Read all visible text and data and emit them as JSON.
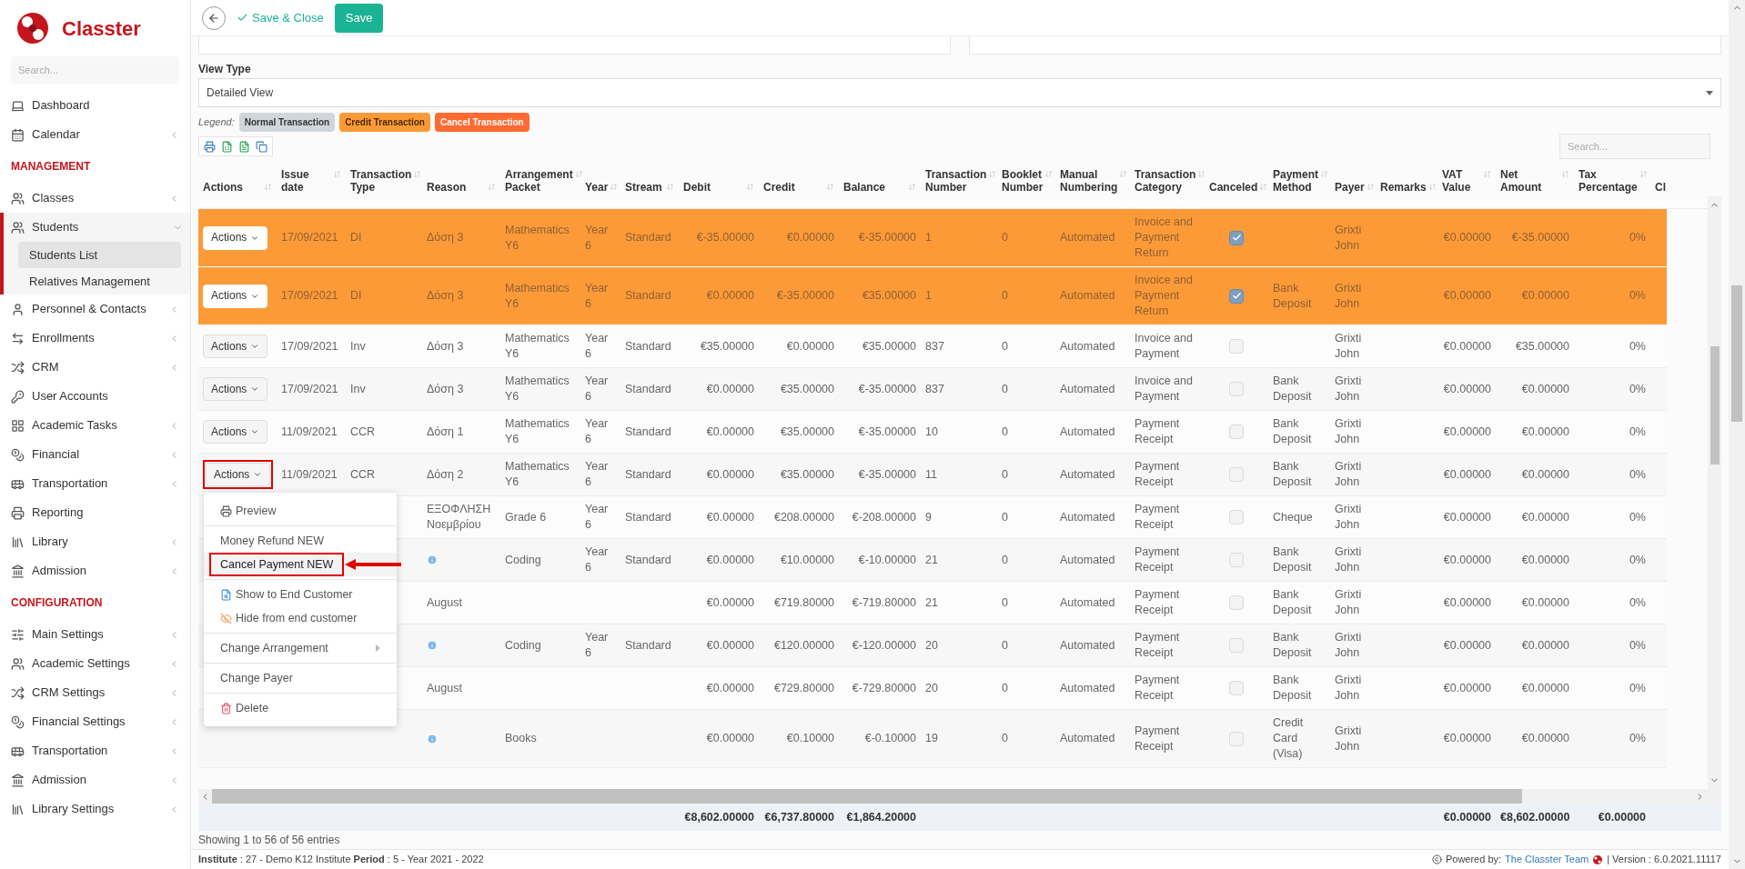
{
  "sidebar": {
    "logo": "Classter",
    "search": {
      "placeholder": "Search..."
    },
    "sections": [
      {
        "items": [
          {
            "label": "Dashboard",
            "submenu": false,
            "expanded": false
          },
          {
            "label": "Calendar",
            "submenu": true,
            "expanded": false
          }
        ]
      },
      {
        "heading": "MANAGEMENT",
        "items": [
          {
            "label": "Classes",
            "submenu": true,
            "expanded": false
          },
          {
            "label": "Students",
            "submenu": true,
            "expanded": true,
            "children": [
              {
                "label": "Students List",
                "selected": true
              },
              {
                "label": "Relatives Management",
                "selected": false
              }
            ]
          },
          {
            "label": "Personnel & Contacts",
            "submenu": true,
            "expanded": false
          },
          {
            "label": "Enrollments",
            "submenu": true,
            "expanded": false
          },
          {
            "label": "CRM",
            "submenu": true,
            "expanded": false
          },
          {
            "label": "User Accounts",
            "submenu": false,
            "expanded": false
          },
          {
            "label": "Academic Tasks",
            "submenu": true,
            "expanded": false
          },
          {
            "label": "Financial",
            "submenu": true,
            "expanded": false
          },
          {
            "label": "Transportation",
            "submenu": true,
            "expanded": false
          },
          {
            "label": "Reporting",
            "submenu": false,
            "expanded": false
          },
          {
            "label": "Library",
            "submenu": true,
            "expanded": false
          },
          {
            "label": "Admission",
            "submenu": true,
            "expanded": false
          }
        ]
      },
      {
        "heading": "CONFIGURATION",
        "items": [
          {
            "label": "Main Settings",
            "submenu": true,
            "expanded": false
          },
          {
            "label": "Academic Settings",
            "submenu": true,
            "expanded": false
          },
          {
            "label": "CRM Settings",
            "submenu": true,
            "expanded": false
          },
          {
            "label": "Financial Settings",
            "submenu": true,
            "expanded": false
          },
          {
            "label": "Transportation",
            "submenu": true,
            "expanded": false
          },
          {
            "label": "Admission",
            "submenu": true,
            "expanded": false
          },
          {
            "label": "Library Settings",
            "submenu": true,
            "expanded": false
          }
        ]
      }
    ]
  },
  "toolbar": {
    "save_close": "Save & Close",
    "save": "Save"
  },
  "view_type": {
    "label": "View Type",
    "value": "Detailed View"
  },
  "legend": {
    "label": "Legend:",
    "items": [
      {
        "label": "Normal Transaction",
        "color": "#d1d6db"
      },
      {
        "label": "Credit Transaction",
        "color": "#fd9a38"
      },
      {
        "label": "Cancel Transaction",
        "color": "#ff6a33"
      }
    ]
  },
  "table_search": {
    "placeholder": "Search..."
  },
  "table": {
    "columns": [
      "Actions",
      "Issue date",
      "Transaction Type",
      "Reason",
      "Arrangement Packet",
      "Year",
      "Stream",
      "Debit",
      "Credit",
      "Balance",
      "Transaction Number",
      "Booklet Number",
      "Manual Numbering",
      "Transaction Category",
      "Canceled",
      "Payment Method",
      "Payer",
      "Remarks",
      "VAT Value",
      "Net Amount",
      "Tax Percentage",
      "Cl"
    ],
    "rows": [
      {
        "kind": "credit",
        "actions": "Actions",
        "actions_highlighted": false,
        "issue_date": "17/09/2021",
        "transaction_type": "DI",
        "reason": "Δόση 3",
        "info": false,
        "arrangement_packet": "Mathematics Y6",
        "year": "Year 6",
        "stream": "Standard",
        "debit": "€-35.00000",
        "credit": "€0.00000",
        "balance": "€-35.00000",
        "transaction_number": "1",
        "booklet_number": "0",
        "manual_numbering": "Automated",
        "transaction_category": "Invoice and Payment Return",
        "canceled": true,
        "payer": "Grixti John",
        "vat_value": "€0.00000",
        "net_amount": "€-35.00000",
        "tax_percentage": "0%"
      },
      {
        "kind": "credit",
        "actions": "Actions",
        "actions_highlighted": false,
        "issue_date": "17/09/2021",
        "transaction_type": "DI",
        "reason": "Δόση 3",
        "info": false,
        "arrangement_packet": "Mathematics Y6",
        "year": "Year 6",
        "stream": "Standard",
        "debit": "€0.00000",
        "credit": "€-35.00000",
        "balance": "€35.00000",
        "transaction_number": "1",
        "booklet_number": "0",
        "manual_numbering": "Automated",
        "transaction_category": "Invoice and Payment Return",
        "canceled": true,
        "payment_method": "Bank Deposit",
        "payer": "Grixti John",
        "vat_value": "€0.00000",
        "net_amount": "€0.00000",
        "tax_percentage": "0%"
      },
      {
        "kind": "normal",
        "actions": "Actions",
        "actions_highlighted": false,
        "issue_date": "17/09/2021",
        "transaction_type": "Inv",
        "reason": "Δόση 3",
        "info": false,
        "arrangement_packet": "Mathematics Y6",
        "year": "Year 6",
        "stream": "Standard",
        "debit": "€35.00000",
        "credit": "€0.00000",
        "balance": "€35.00000",
        "transaction_number": "837",
        "booklet_number": "0",
        "manual_numbering": "Automated",
        "transaction_category": "Invoice and Payment",
        "canceled": false,
        "payer": "Grixti John",
        "vat_value": "€0.00000",
        "net_amount": "€35.00000",
        "tax_percentage": "0%"
      },
      {
        "kind": "normal",
        "actions": "Actions",
        "actions_highlighted": false,
        "issue_date": "17/09/2021",
        "transaction_type": "Inv",
        "reason": "Δόση 3",
        "info": false,
        "arrangement_packet": "Mathematics Y6",
        "year": "Year 6",
        "stream": "Standard",
        "debit": "€0.00000",
        "credit": "€35.00000",
        "balance": "€-35.00000",
        "transaction_number": "837",
        "booklet_number": "0",
        "manual_numbering": "Automated",
        "transaction_category": "Invoice and Payment",
        "canceled": false,
        "payment_method": "Bank Deposit",
        "payer": "Grixti John",
        "vat_value": "€0.00000",
        "net_amount": "€0.00000",
        "tax_percentage": "0%"
      },
      {
        "kind": "normal",
        "actions": "Actions",
        "actions_highlighted": false,
        "issue_date": "11/09/2021",
        "transaction_type": "CCR",
        "reason": "Δόση 1",
        "info": false,
        "arrangement_packet": "Mathematics Y6",
        "year": "Year 6",
        "stream": "Standard",
        "debit": "€0.00000",
        "credit": "€35.00000",
        "balance": "€-35.00000",
        "transaction_number": "10",
        "booklet_number": "0",
        "manual_numbering": "Automated",
        "transaction_category": "Payment Receipt",
        "canceled": false,
        "payment_method": "Bank Deposit",
        "payer": "Grixti John",
        "vat_value": "€0.00000",
        "net_amount": "€0.00000",
        "tax_percentage": "0%"
      },
      {
        "kind": "normal",
        "actions": "Actions",
        "actions_highlighted": true,
        "issue_date": "11/09/2021",
        "transaction_type": "CCR",
        "reason": "Δόση 2",
        "info": false,
        "arrangement_packet": "Mathematics Y6",
        "year": "Year 6",
        "stream": "Standard",
        "debit": "€0.00000",
        "credit": "€35.00000",
        "balance": "€-35.00000",
        "transaction_number": "11",
        "booklet_number": "0",
        "manual_numbering": "Automated",
        "transaction_category": "Payment Receipt",
        "canceled": false,
        "payment_method": "Bank Deposit",
        "payer": "Grixti John",
        "vat_value": "€0.00000",
        "net_amount": "€0.00000",
        "tax_percentage": "0%"
      },
      {
        "kind": "normal",
        "reason": "ΕΞΟΦΛΗΣΗ Νοεμβρίου",
        "info": false,
        "arrangement_packet": "Grade 6",
        "year": "Year 6",
        "stream": "Standard",
        "debit": "€0.00000",
        "credit": "€208.00000",
        "balance": "€-208.00000",
        "transaction_number": "9",
        "booklet_number": "0",
        "manual_numbering": "Automated",
        "transaction_category": "Payment Receipt",
        "canceled": false,
        "payment_method": "Cheque",
        "payer": "Grixti John",
        "vat_value": "€0.00000",
        "net_amount": "€0.00000",
        "tax_percentage": "0%"
      },
      {
        "kind": "normal",
        "info": true,
        "arrangement_packet": "Coding",
        "year": "Year 6",
        "stream": "Standard",
        "debit": "€0.00000",
        "credit": "€10.00000",
        "balance": "€-10.00000",
        "transaction_number": "21",
        "booklet_number": "0",
        "manual_numbering": "Automated",
        "transaction_category": "Payment Receipt",
        "canceled": false,
        "payment_method": "Bank Deposit",
        "payer": "Grixti John",
        "vat_value": "€0.00000",
        "net_amount": "€0.00000",
        "tax_percentage": "0%"
      },
      {
        "kind": "normal",
        "reason": "August",
        "info": false,
        "debit": "€0.00000",
        "credit": "€719.80000",
        "balance": "€-719.80000",
        "transaction_number": "21",
        "booklet_number": "0",
        "manual_numbering": "Automated",
        "transaction_category": "Payment Receipt",
        "canceled": false,
        "payment_method": "Bank Deposit",
        "payer": "Grixti John",
        "vat_value": "€0.00000",
        "net_amount": "€0.00000",
        "tax_percentage": "0%"
      },
      {
        "kind": "normal",
        "info": true,
        "arrangement_packet": "Coding",
        "year": "Year 6",
        "stream": "Standard",
        "debit": "€0.00000",
        "credit": "€120.00000",
        "balance": "€-120.00000",
        "transaction_number": "20",
        "booklet_number": "0",
        "manual_numbering": "Automated",
        "transaction_category": "Payment Receipt",
        "canceled": false,
        "payment_method": "Bank Deposit",
        "payer": "Grixti John",
        "vat_value": "€0.00000",
        "net_amount": "€0.00000",
        "tax_percentage": "0%"
      },
      {
        "kind": "normal",
        "reason": "August",
        "info": false,
        "debit": "€0.00000",
        "credit": "€729.80000",
        "balance": "€-729.80000",
        "transaction_number": "20",
        "booklet_number": "0",
        "manual_numbering": "Automated",
        "transaction_category": "Payment Receipt",
        "canceled": false,
        "payment_method": "Bank Deposit",
        "payer": "Grixti John",
        "vat_value": "€0.00000",
        "net_amount": "€0.00000",
        "tax_percentage": "0%"
      },
      {
        "kind": "normal",
        "info": true,
        "arrangement_packet": "Books",
        "debit": "€0.00000",
        "credit": "€0.10000",
        "balance": "€-0.10000",
        "transaction_number": "19",
        "booklet_number": "0",
        "manual_numbering": "Automated",
        "transaction_category": "Payment Receipt",
        "canceled": false,
        "payment_method": "Credit Card (Visa)",
        "payer": "Grixti John",
        "vat_value": "€0.00000",
        "net_amount": "€0.00000",
        "tax_percentage": "0%"
      }
    ],
    "totals": {
      "debit": "€8,602.00000",
      "credit": "€6,737.80000",
      "balance": "€1,864.20000",
      "vat_value": "€0.00000",
      "net_amount": "€8,602.00000",
      "tax_percentage": "€0.00000"
    },
    "info_text": "Showing 1 to 56 of 56 entries"
  },
  "actions_menu": {
    "groups": [
      [
        {
          "label": "Preview",
          "highlighted": false,
          "submenu": false
        }
      ],
      [
        {
          "label": "Money Refund NEW",
          "highlighted": false,
          "submenu": false
        },
        {
          "label": "Cancel Payment NEW",
          "highlighted": true,
          "submenu": false
        }
      ],
      [
        {
          "label": "Show to End Customer",
          "highlighted": false,
          "submenu": false
        },
        {
          "label": "Hide from end customer",
          "highlighted": false,
          "submenu": false
        }
      ],
      [
        {
          "label": "Change Arrangement",
          "highlighted": false,
          "submenu": true
        }
      ],
      [
        {
          "label": "Change Payer",
          "highlighted": false,
          "submenu": false
        }
      ],
      [
        {
          "label": "Delete",
          "highlighted": false,
          "submenu": false
        }
      ]
    ]
  },
  "status_bar": {
    "context": "**Institute** : 27 - Demo K12 Institute **Period** : 5 - Year 2021 - 2022",
    "powered_by": "Powered by:",
    "link": "The Classter Team",
    "version": "| Version : 6.0.2021.11117"
  }
}
